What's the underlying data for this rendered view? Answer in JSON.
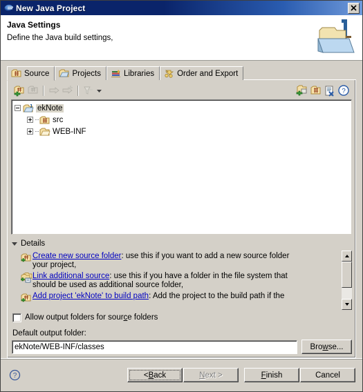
{
  "window": {
    "title": "New Java Project",
    "close_label": "✕",
    "close_icon": "close-icon",
    "title_icon": "eclipse-java-icon",
    "titlebar_color": "#0a246a",
    "dialog_background": "#d4d0c8"
  },
  "header": {
    "title": "Java Settings",
    "subtitle": "Define the Java build settings,",
    "icon": "java-project-folder-icon"
  },
  "tabs": [
    {
      "label": "Source",
      "icon": "source-folder-icon",
      "selected": true
    },
    {
      "label": "Projects",
      "icon": "projects-folder-icon",
      "selected": false
    },
    {
      "label": "Libraries",
      "icon": "libraries-books-icon",
      "selected": false
    },
    {
      "label": "Order and Export",
      "icon": "order-export-arrows-icon",
      "selected": false
    }
  ],
  "toolbar": {
    "left_buttons": [
      {
        "name": "add-folder-button",
        "icon": "add-source-folder-icon",
        "enabled": true
      },
      {
        "name": "remove-folder-button",
        "icon": "remove-source-folder-icon",
        "enabled": false
      }
    ],
    "middle_buttons": [
      {
        "name": "link-source-button",
        "icon": "link-source-arrow-icon",
        "enabled": false
      },
      {
        "name": "add-link-button",
        "icon": "add-link-arrow-icon",
        "enabled": false
      }
    ],
    "filter_buttons": [
      {
        "name": "configure-filters-button",
        "icon": "filter-icon",
        "enabled": false
      }
    ],
    "caret": {
      "name": "toolbar-dropdown-caret",
      "icon": "chevron-down-icon"
    },
    "right_buttons": [
      {
        "name": "create-new-source-folder-button",
        "icon": "new-source-folder-icon",
        "enabled": true
      },
      {
        "name": "add-folder-to-buildpath-button",
        "icon": "folder-buildpath-icon",
        "enabled": true
      },
      {
        "name": "remove-from-buildpath-button",
        "icon": "remove-buildpath-icon",
        "enabled": true
      },
      {
        "name": "help-button",
        "icon": "question-mark-icon",
        "enabled": true
      }
    ]
  },
  "tree": {
    "nodes": [
      {
        "label": "ekNote",
        "icon": "java-project-icon",
        "expander": "minus",
        "indent": 0,
        "selected": true
      },
      {
        "label": "src",
        "icon": "source-folder-icon",
        "expander": "plus",
        "indent": 1,
        "selected": false
      },
      {
        "label": "WEB-INF",
        "icon": "folder-icon",
        "expander": "plus",
        "indent": 1,
        "selected": false
      }
    ]
  },
  "details": {
    "header_label": "Details",
    "expanded": true,
    "items": [
      {
        "icon": "create-source-folder-icon",
        "link": "Create new source folder",
        "text_line1": ": use this if you want to add a new source folder",
        "text_line2": "your project,"
      },
      {
        "icon": "link-additional-source-icon",
        "link": "Link additional source",
        "text_line1": ": use this if you have a folder in the file system that",
        "text_line2": "should be used as additional source folder,"
      },
      {
        "icon": "add-project-buildpath-icon",
        "link": "Add project 'ekNote' to build path",
        "text_line1": ": Add the project to the build path if the",
        "text_line2": ""
      }
    ],
    "scrollbar": {
      "up_name": "scroll-up-arrow",
      "down_name": "scroll-down-arrow",
      "thumb_name": "scroll-thumb"
    }
  },
  "allow_output": {
    "label_prefix": "Allow output folders for sour",
    "label_mnemonic": "c",
    "label_suffix": "e folders",
    "checked": false
  },
  "output_folder": {
    "label": "Default output folder:",
    "value": "ekNote/WEB-INF/classes",
    "placeholder": "",
    "browse_label_prefix": "Bro",
    "browse_label_mnemonic": "w",
    "browse_label_suffix": "se..."
  },
  "footer": {
    "help_icon": "question-mark-circle-icon",
    "buttons": [
      {
        "name": "back-button",
        "prefix": "< ",
        "mnemonic": "B",
        "suffix": "ack",
        "enabled": true,
        "default": true
      },
      {
        "name": "next-button",
        "prefix": "",
        "mnemonic": "N",
        "suffix": "ext >",
        "enabled": false,
        "default": false
      },
      {
        "name": "finish-button",
        "prefix": "",
        "mnemonic": "F",
        "suffix": "inish",
        "enabled": true,
        "default": false
      },
      {
        "name": "cancel-button",
        "prefix": "",
        "mnemonic": "",
        "suffix": "Cancel",
        "enabled": true,
        "default": false
      }
    ]
  }
}
